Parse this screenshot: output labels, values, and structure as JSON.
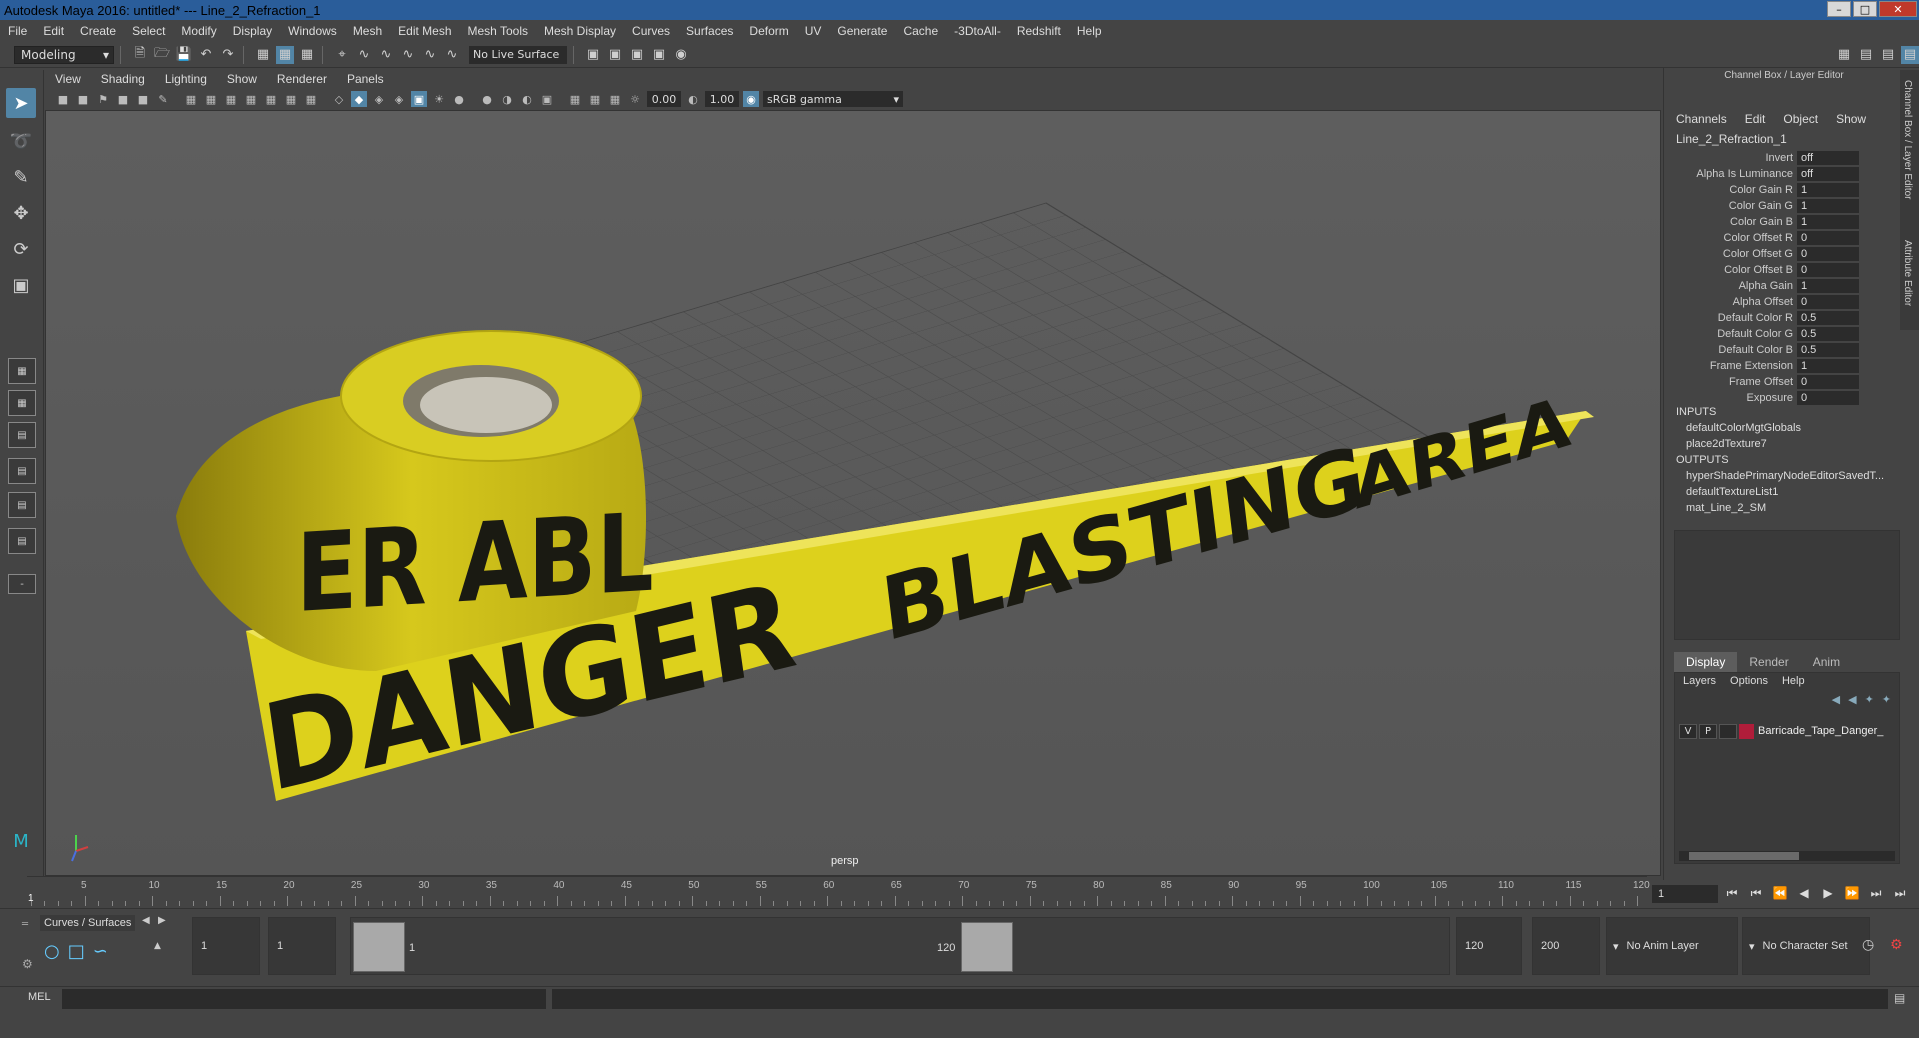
{
  "window": {
    "title": "Autodesk Maya 2016: untitled*   ---   Line_2_Refraction_1"
  },
  "menubar": [
    "File",
    "Edit",
    "Create",
    "Select",
    "Modify",
    "Display",
    "Windows",
    "Mesh",
    "Edit Mesh",
    "Mesh Tools",
    "Mesh Display",
    "Curves",
    "Surfaces",
    "Deform",
    "UV",
    "Generate",
    "Cache",
    "-3DtoAll-",
    "Redshift",
    "Help"
  ],
  "shelf": {
    "mode": "Modeling",
    "live_surface": "No Live Surface"
  },
  "panel": {
    "menu": [
      "View",
      "Shading",
      "Lighting",
      "Show",
      "Renderer",
      "Panels"
    ],
    "exposure": "0.00",
    "gamma": "1.00",
    "color_space": "sRGB gamma",
    "camera_label": "persp"
  },
  "viewport_scene": {
    "tape_text_1": "DANGER",
    "tape_text_2": "BLASTING",
    "tape_text_3": "AREA",
    "roll_text": "ER  ABL",
    "tape_color": "#e3d41c",
    "text_color": "#1a1a12"
  },
  "channel_box": {
    "title": "Channel Box / Layer Editor",
    "menu": [
      "Channels",
      "Edit",
      "Object",
      "Show"
    ],
    "node": "Line_2_Refraction_1",
    "attributes": [
      {
        "label": "Invert",
        "value": "off"
      },
      {
        "label": "Alpha Is Luminance",
        "value": "off"
      },
      {
        "label": "Color Gain R",
        "value": "1"
      },
      {
        "label": "Color Gain G",
        "value": "1"
      },
      {
        "label": "Color Gain B",
        "value": "1"
      },
      {
        "label": "Color Offset R",
        "value": "0"
      },
      {
        "label": "Color Offset G",
        "value": "0"
      },
      {
        "label": "Color Offset B",
        "value": "0"
      },
      {
        "label": "Alpha Gain",
        "value": "1"
      },
      {
        "label": "Alpha Offset",
        "value": "0"
      },
      {
        "label": "Default Color R",
        "value": "0.5"
      },
      {
        "label": "Default Color G",
        "value": "0.5"
      },
      {
        "label": "Default Color B",
        "value": "0.5"
      },
      {
        "label": "Frame Extension",
        "value": "1"
      },
      {
        "label": "Frame Offset",
        "value": "0"
      },
      {
        "label": "Exposure",
        "value": "0"
      }
    ],
    "inputs_label": "INPUTS",
    "inputs": [
      "defaultColorMgtGlobals",
      "place2dTexture7"
    ],
    "outputs_label": "OUTPUTS",
    "outputs": [
      "hyperShadePrimaryNodeEditorSavedT...",
      "defaultTextureList1",
      "mat_Line_2_SM"
    ]
  },
  "side_tabs": [
    "Channel Box / Layer Editor",
    "Attribute Editor"
  ],
  "layer_editor": {
    "tabs": [
      "Display",
      "Render",
      "Anim"
    ],
    "menu": [
      "Layers",
      "Options",
      "Help"
    ],
    "layer": {
      "v": "V",
      "p": "P",
      "name": "Barricade_Tape_Danger_",
      "color": "#b01d3a"
    }
  },
  "timeline": {
    "ticks": [
      "5",
      "10",
      "15",
      "20",
      "25",
      "30",
      "35",
      "40",
      "45",
      "50",
      "55",
      "60",
      "65",
      "70",
      "75",
      "80",
      "85",
      "90",
      "95",
      "100",
      "105",
      "110",
      "115",
      "120"
    ],
    "current_frame_label": "1",
    "current_frame": "1"
  },
  "range": {
    "shelf_tab": "Curves / Surfaces",
    "start": "1",
    "playback_start": "1",
    "slider_start": "1",
    "slider_end": "120",
    "playback_end": "120",
    "end": "200",
    "anim_layer": "No Anim Layer",
    "character_set": "No Character Set"
  },
  "command_line": {
    "label": "MEL"
  }
}
